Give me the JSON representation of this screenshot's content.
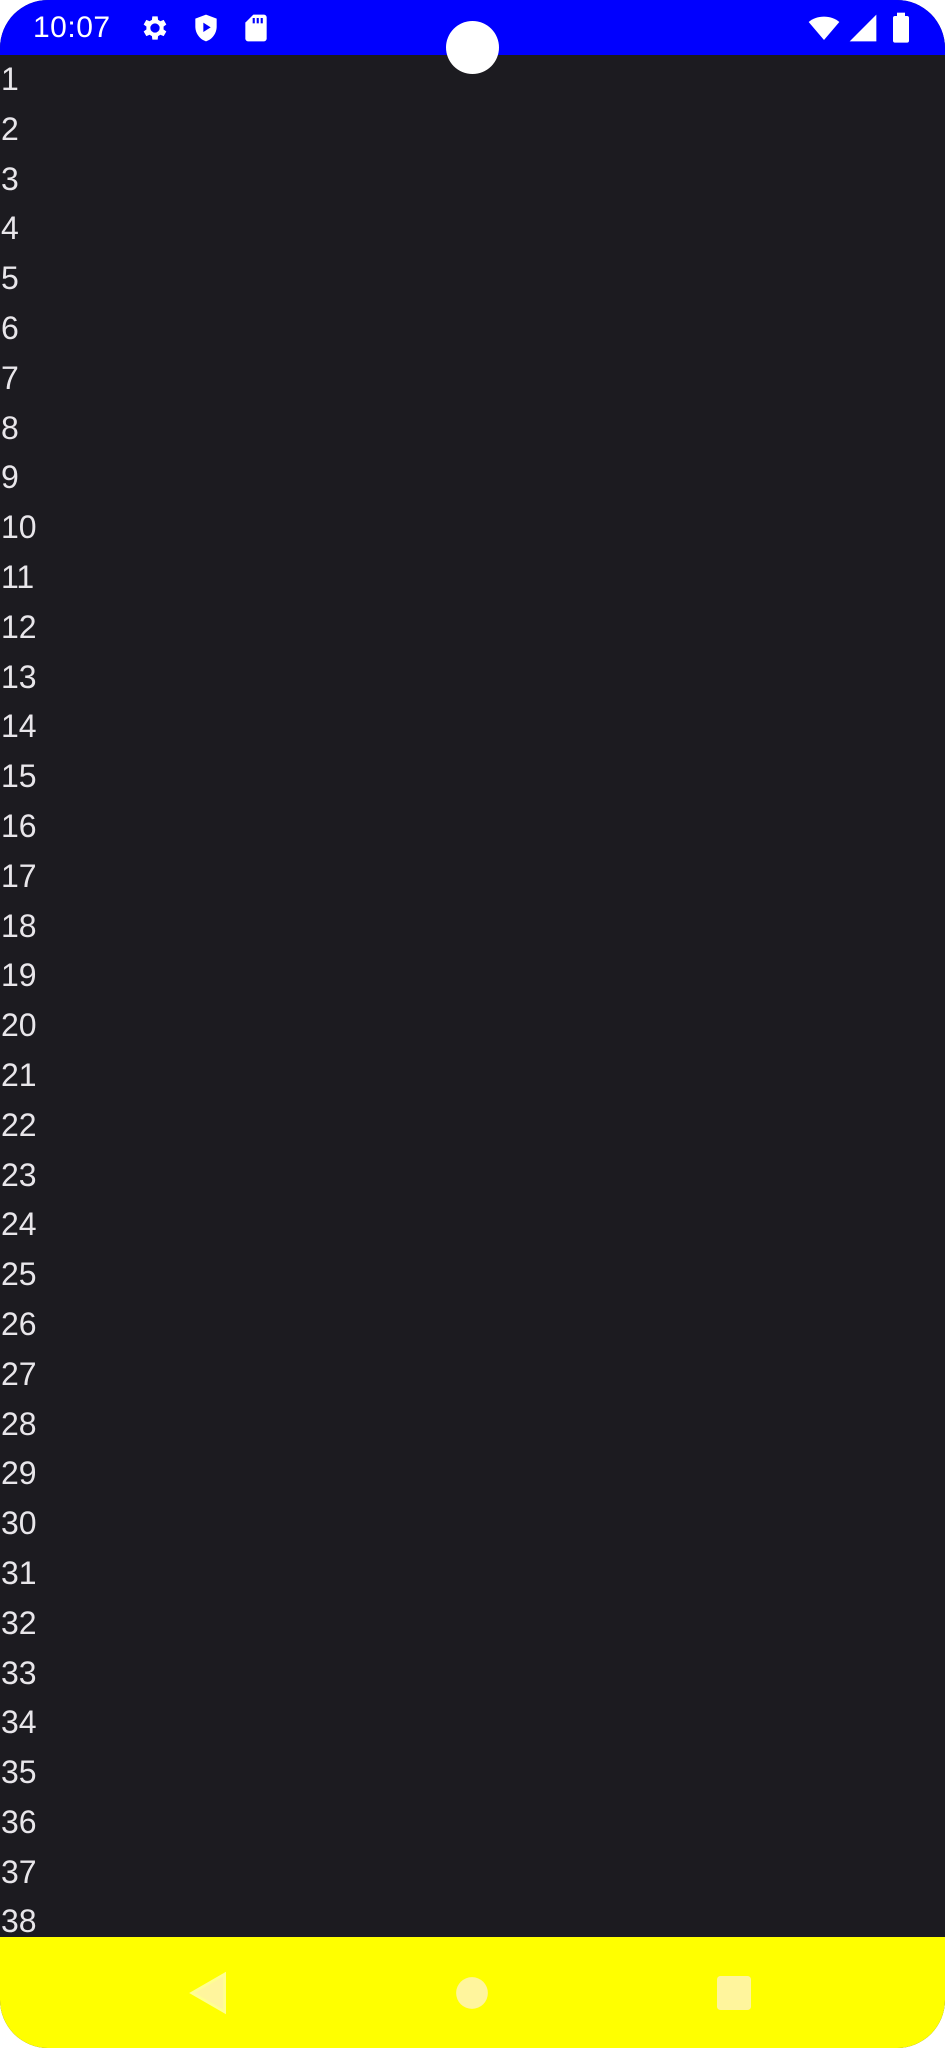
{
  "status_bar": {
    "time": "10:07",
    "background": "#0000ff",
    "left_icons": [
      "settings-gear-icon",
      "play-protect-shield-icon",
      "sd-card-icon"
    ],
    "right_icons": [
      "wifi-icon",
      "cell-signal-icon",
      "battery-icon"
    ]
  },
  "list": {
    "background": "#1c1b20",
    "items": [
      "1",
      "2",
      "3",
      "4",
      "5",
      "6",
      "7",
      "8",
      "9",
      "10",
      "11",
      "12",
      "13",
      "14",
      "15",
      "16",
      "17",
      "18",
      "19",
      "20",
      "21",
      "22",
      "23",
      "24",
      "25",
      "26",
      "27",
      "28",
      "29",
      "30",
      "31",
      "32",
      "33",
      "34",
      "35",
      "36",
      "37",
      "38"
    ]
  },
  "nav_bar": {
    "background": "#ffff00",
    "buttons": [
      "back-icon",
      "home-icon",
      "recents-icon"
    ]
  }
}
